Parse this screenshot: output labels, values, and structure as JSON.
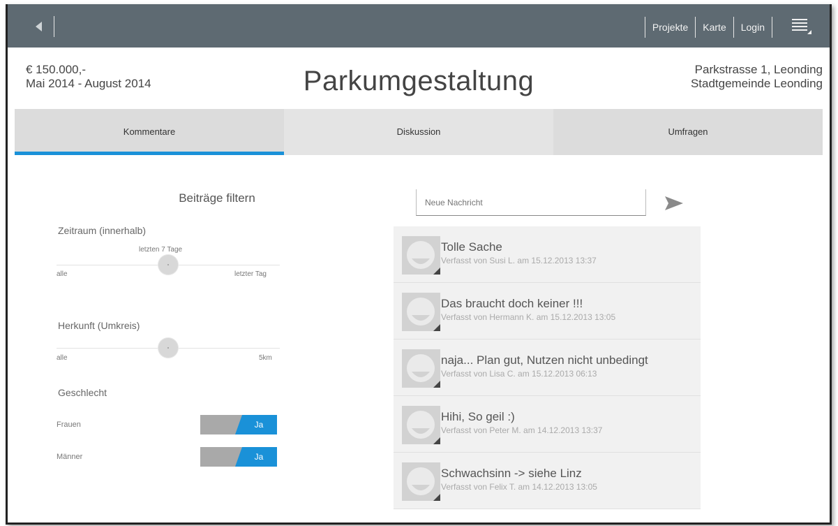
{
  "nav": {
    "links": [
      "Projekte",
      "Karte",
      "Login"
    ]
  },
  "header": {
    "budget": "€ 150.000,-",
    "period": "Mai 2014 - August 2014",
    "title": "Parkumgestaltung",
    "address_line1": "Parkstrasse 1, Leonding",
    "address_line2": "Stadtgemeinde Leonding"
  },
  "tabs": [
    "Kommentare",
    "Diskussion",
    "Umfragen"
  ],
  "filters": {
    "title": "Beiträge filtern",
    "timeframe_label": "Zeitraum (innerhalb)",
    "timeframe_value": "letzten 7 Tage",
    "timeframe_min": "alle",
    "timeframe_max": "letzter Tag",
    "timeframe_level": 0.5,
    "origin_label": "Herkunft (Umkreis)",
    "origin_min": "alle",
    "origin_max": "5km",
    "origin_level": 0.5,
    "gender_label": "Geschlecht",
    "women_label": "Frauen",
    "women_toggle": "Ja",
    "men_label": "Männer",
    "men_toggle": "Ja"
  },
  "composer": {
    "placeholder": "Neue Nachricht"
  },
  "comments": [
    {
      "title": "Tolle Sache",
      "meta": "Verfasst von Susi L. am 15.12.2013 13:37"
    },
    {
      "title": "Das braucht doch keiner !!!",
      "meta": "Verfasst von Hermann K. am 15.12.2013 13:05"
    },
    {
      "title": "naja... Plan gut, Nutzen nicht unbedingt",
      "meta": "Verfasst von Lisa C. am 15.12.2013 06:13"
    },
    {
      "title": "Hihi, So geil :)",
      "meta": "Verfasst von Peter M. am 14.12.2013 13:37"
    },
    {
      "title": "Schwachsinn -> siehe Linz",
      "meta": "Verfasst von Felix T. am 14.12.2013 13:05"
    }
  ],
  "colors": {
    "topbar": "#5e6a72",
    "accent": "#1a91d8",
    "tabs": "#dcdcdc"
  }
}
